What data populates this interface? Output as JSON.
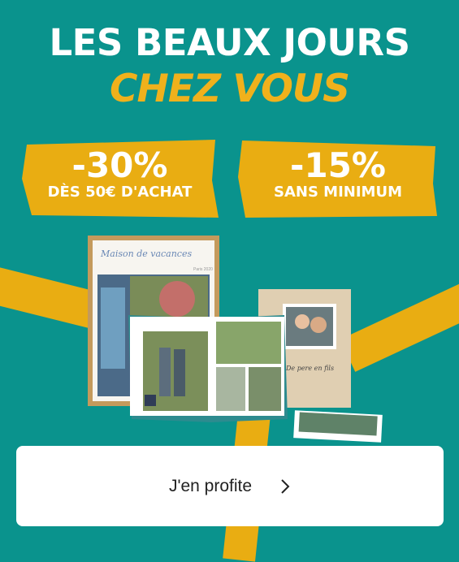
{
  "headline": {
    "line1": "LES BEAUX JOURS",
    "line2": "CHEZ VOUS"
  },
  "offers": [
    {
      "percent": "-30%",
      "condition": "DÈS 50€ D'ACHAT"
    },
    {
      "percent": "-15%",
      "condition": "SANS MINIMUM"
    }
  ],
  "products": {
    "frame_title": "Maison de vacances",
    "frame_subtitle": "Paris 2020",
    "book_title": "De pere en fils"
  },
  "cta": {
    "label": "J'en profite",
    "icon": "chevron-right-icon"
  },
  "colors": {
    "background": "#0a938d",
    "accent": "#e9ad12",
    "button": "#ffffff"
  }
}
